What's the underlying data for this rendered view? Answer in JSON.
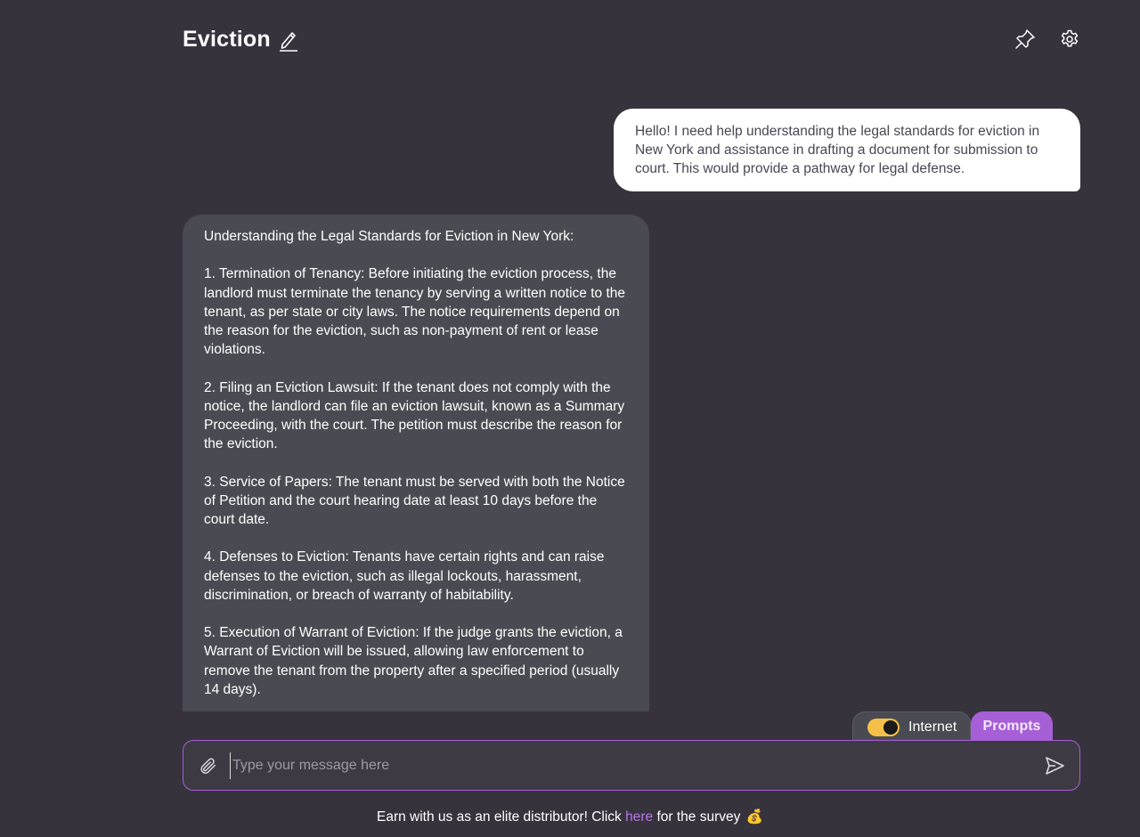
{
  "header": {
    "title": "Eviction"
  },
  "chat": {
    "user_message": "Hello! I need help understanding the legal standards for eviction in New York and assistance in drafting a document for submission to court. This would provide a pathway for legal defense.",
    "bot_paragraphs": [
      "Understanding the Legal Standards for Eviction in New York:",
      "1. Termination of Tenancy: Before initiating the eviction process, the landlord must terminate the tenancy by serving a written notice to the tenant, as per state or city laws. The notice requirements depend on the reason for the eviction, such as non-payment of rent or lease violations.",
      "2. Filing an Eviction Lawsuit: If the tenant does not comply with the notice, the landlord can file an eviction lawsuit, known as a Summary Proceeding, with the court. The petition must describe the reason for the eviction.",
      "3. Service of Papers: The tenant must be served with both the Notice of Petition and the court hearing date at least 10 days before the court date.",
      "4. Defenses to Eviction: Tenants have certain rights and can raise defenses to the eviction, such as illegal lockouts, harassment, discrimination, or breach of warranty of habitability.",
      "5. Execution of Warrant of Eviction: If the judge grants the eviction, a Warrant of Eviction will be issued, allowing law enforcement to remove the tenant from the property after a specified period (usually 14 days)."
    ]
  },
  "tools": {
    "internet_label": "Internet",
    "internet_enabled": true,
    "prompts_label": "Prompts"
  },
  "composer": {
    "placeholder": "Type your message here",
    "value": ""
  },
  "footer": {
    "text_before": "Earn with us as an elite distributor! Click ",
    "link_text": "here",
    "text_after": " for the survey",
    "emoji": "💰"
  },
  "colors": {
    "background": "#36333d",
    "accent": "#a65fd6",
    "toggle_on": "#f5c04a",
    "bot_bubble": "#4a4a52",
    "user_bubble": "#ffffff"
  },
  "icons": {
    "edit": "pencil-icon",
    "pin": "pin-icon",
    "settings": "gear-icon",
    "attach": "paperclip-icon",
    "send": "send-icon"
  }
}
